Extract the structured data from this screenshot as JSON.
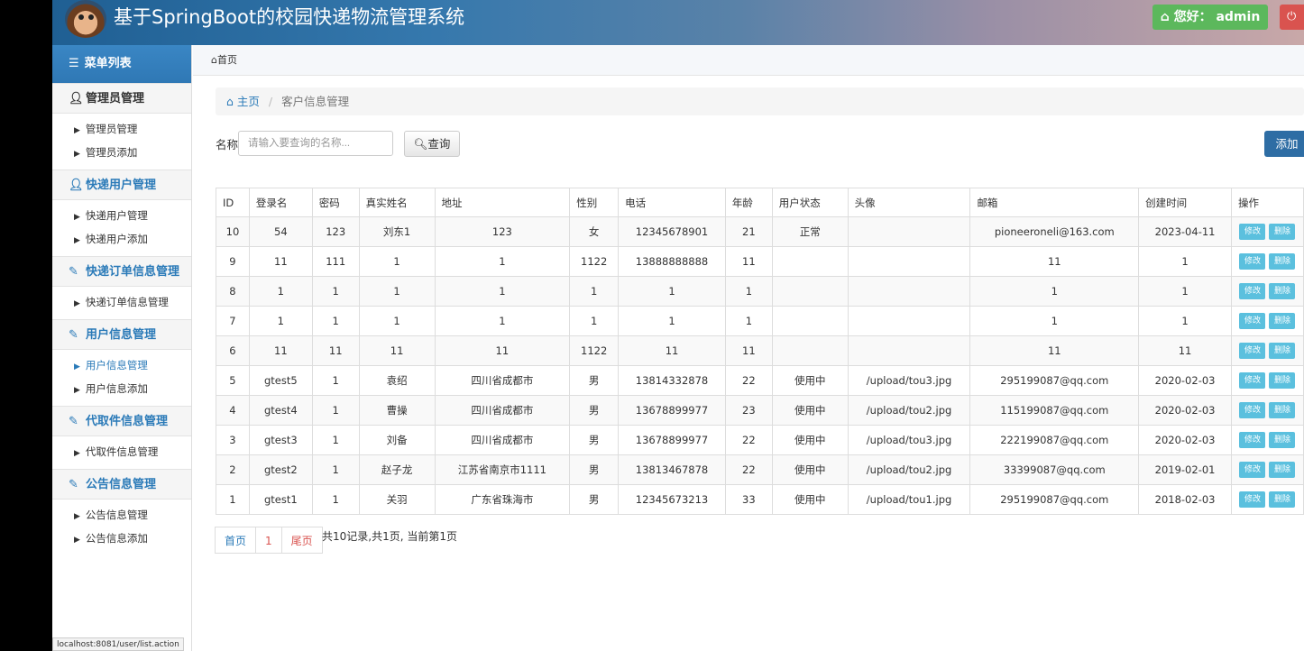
{
  "header": {
    "title": "基于SpringBoot的校园快递物流管理系统",
    "greeting": "您好：  admin"
  },
  "sidebar": {
    "menu_title": "菜单列表",
    "groups": [
      {
        "title": "管理员管理",
        "icon": "user-icon",
        "items": [
          "管理员管理",
          "管理员添加"
        ]
      },
      {
        "title": "快递用户管理",
        "icon": "user-icon",
        "items": [
          "快递用户管理",
          "快递用户添加"
        ]
      },
      {
        "title": "快递订单信息管理",
        "icon": "edit-icon",
        "items": [
          "快递订单信息管理"
        ]
      },
      {
        "title": "用户信息管理",
        "icon": "edit-icon",
        "items": [
          "用户信息管理",
          "用户信息添加"
        ]
      },
      {
        "title": "代取件信息管理",
        "icon": "edit-icon",
        "items": [
          "代取件信息管理"
        ]
      },
      {
        "title": "公告信息管理",
        "icon": "edit-icon",
        "items": [
          "公告信息管理",
          "公告信息添加"
        ]
      }
    ],
    "status_url": "localhost:8081/user/list.action"
  },
  "main": {
    "top_crumb": "首页",
    "breadcrumb": {
      "home": "主页",
      "current": "客户信息管理"
    },
    "search": {
      "label": "名称",
      "placeholder": "请输入要查询的名称...",
      "button": "查询"
    },
    "add_button": "添加",
    "table": {
      "headers": [
        "ID",
        "登录名",
        "密码",
        "真实姓名",
        "地址",
        "性别",
        "电话",
        "年龄",
        "用户状态",
        "头像",
        "邮箱",
        "创建时间",
        "操作"
      ],
      "rows": [
        [
          "10",
          "54",
          "123",
          "刘东1",
          "123",
          "女",
          "12345678901",
          "21",
          "正常",
          "",
          "pioneeroneli@163.com",
          "2023-04-11"
        ],
        [
          "9",
          "11",
          "111",
          "1",
          "1",
          "1122",
          "13888888888",
          "11",
          "",
          "",
          "11",
          "1"
        ],
        [
          "8",
          "1",
          "1",
          "1",
          "1",
          "1",
          "1",
          "1",
          "",
          "",
          "1",
          "1"
        ],
        [
          "7",
          "1",
          "1",
          "1",
          "1",
          "1",
          "1",
          "1",
          "",
          "",
          "1",
          "1"
        ],
        [
          "6",
          "11",
          "11",
          "11",
          "11",
          "1122",
          "11",
          "11",
          "",
          "",
          "11",
          "11"
        ],
        [
          "5",
          "gtest5",
          "1",
          "袁绍",
          "四川省成都市",
          "男",
          "13814332878",
          "22",
          "使用中",
          "/upload/tou3.jpg",
          "295199087@qq.com",
          "2020-02-03"
        ],
        [
          "4",
          "gtest4",
          "1",
          "曹操",
          "四川省成都市",
          "男",
          "13678899977",
          "23",
          "使用中",
          "/upload/tou2.jpg",
          "115199087@qq.com",
          "2020-02-03"
        ],
        [
          "3",
          "gtest3",
          "1",
          "刘备",
          "四川省成都市",
          "男",
          "13678899977",
          "22",
          "使用中",
          "/upload/tou3.jpg",
          "222199087@qq.com",
          "2020-02-03"
        ],
        [
          "2",
          "gtest2",
          "1",
          "赵子龙",
          "江苏省南京市1111",
          "男",
          "13813467878",
          "22",
          "使用中",
          "/upload/tou2.jpg",
          "33399087@qq.com",
          "2019-02-01"
        ],
        [
          "1",
          "gtest1",
          "1",
          "关羽",
          "广东省珠海市",
          "男",
          "12345673213",
          "33",
          "使用中",
          "/upload/tou1.jpg",
          "295199087@qq.com",
          "2018-02-03"
        ]
      ],
      "edit_label": "修改",
      "delete_label": "删除"
    },
    "pager": {
      "first": "首页",
      "current": "1",
      "last": "尾页",
      "info": "共10记录,共1页, 当前第1页"
    }
  },
  "colors": {
    "accent": "#2a7ab8",
    "success": "#5cb85c",
    "danger": "#d9534f",
    "info": "#5bc0de",
    "primary": "#2e6da4"
  }
}
